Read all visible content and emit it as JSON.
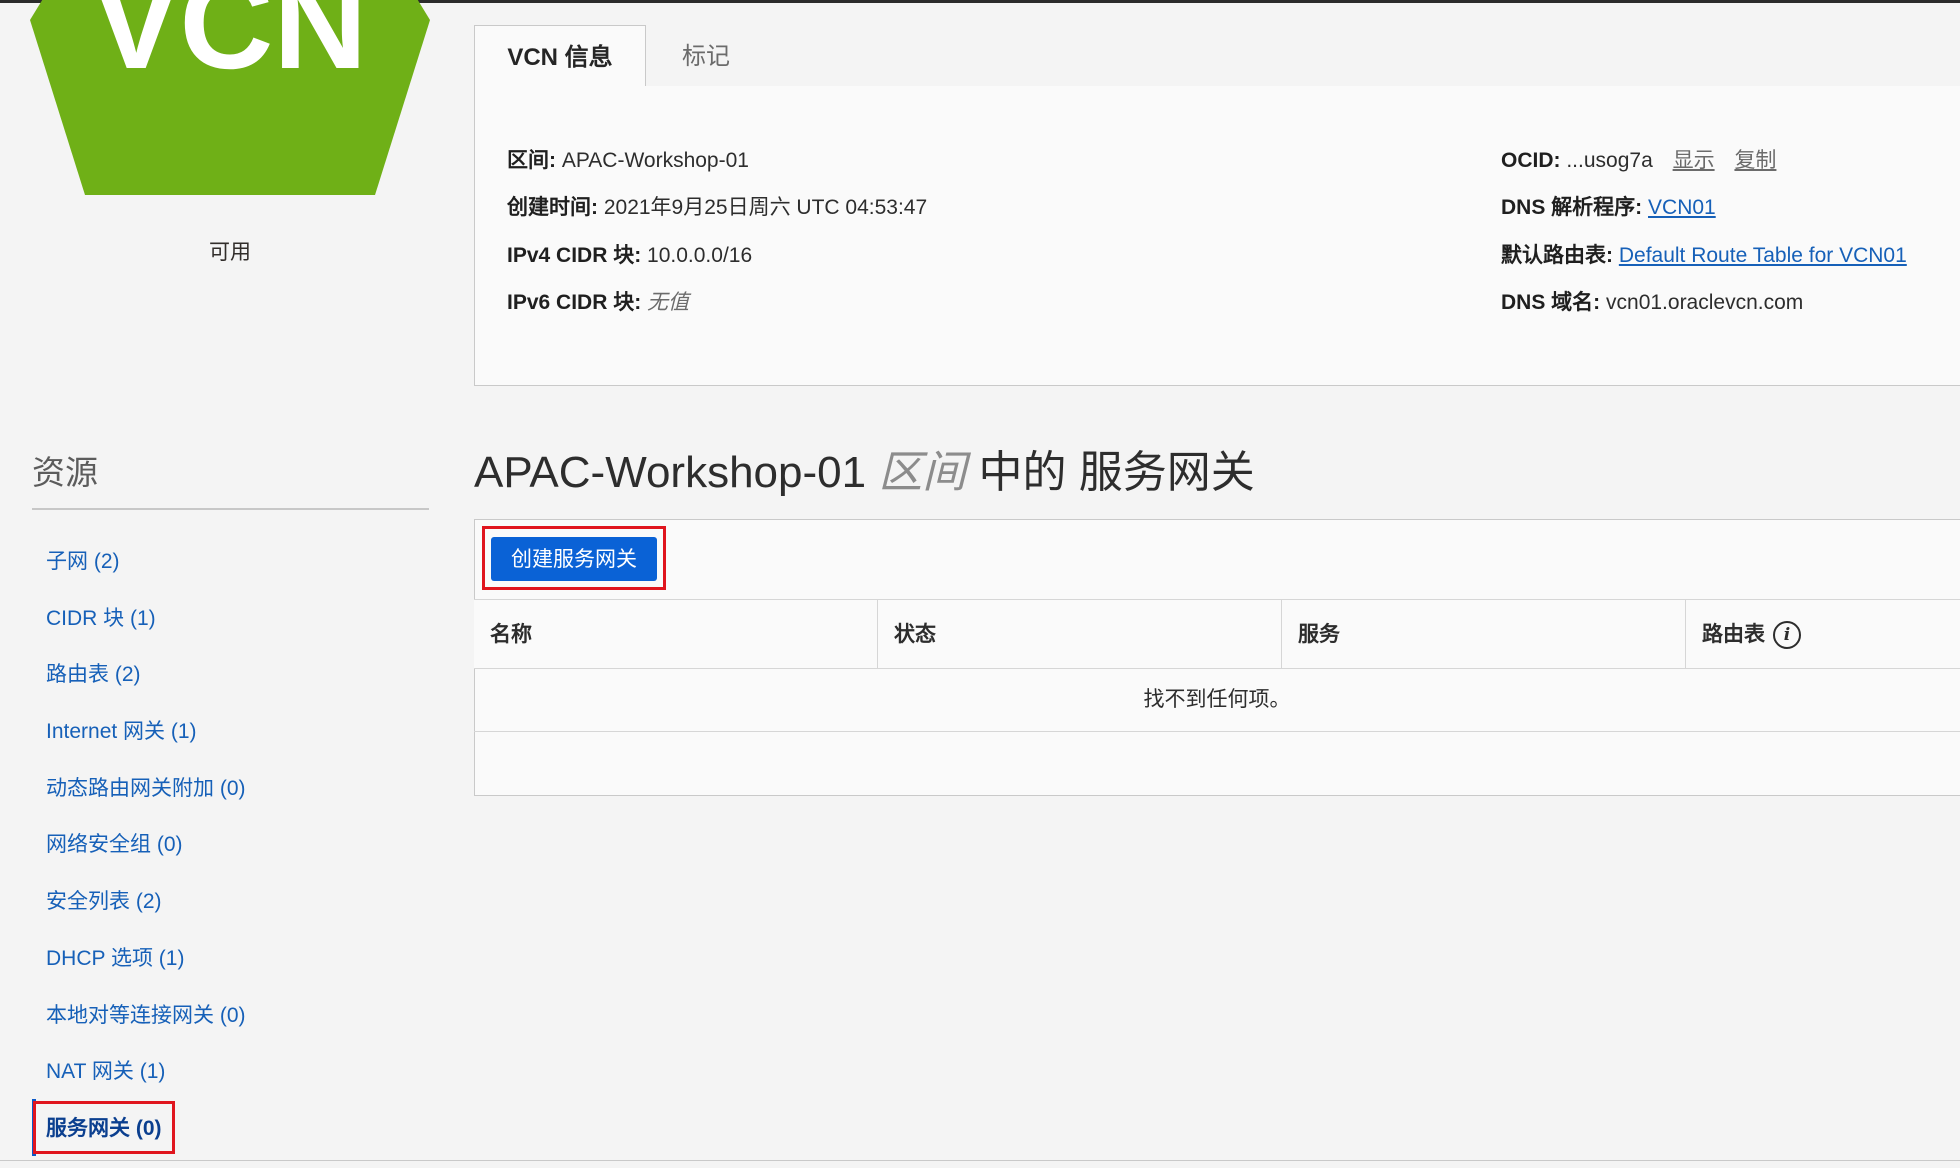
{
  "badge": {
    "text": "VCN",
    "status": "可用",
    "color": "#6fb017"
  },
  "tabs": [
    {
      "label": "VCN 信息",
      "active": true
    },
    {
      "label": "标记",
      "active": false
    }
  ],
  "info": {
    "compartment_key": "区间:",
    "compartment_value": "APAC-Workshop-01",
    "created_key": "创建时间:",
    "created_value": "2021年9月25日周六 UTC 04:53:47",
    "ipv4_key": "IPv4 CIDR 块:",
    "ipv4_value": "10.0.0.0/16",
    "ipv6_key": "IPv6 CIDR 块:",
    "ipv6_value": "无值",
    "ocid_key": "OCID:",
    "ocid_value": "...usog7a",
    "ocid_show": "显示",
    "ocid_copy": "复制",
    "dns_resolver_key": "DNS 解析程序:",
    "dns_resolver_value": "VCN01",
    "route_table_key": "默认路由表:",
    "route_table_value": "Default Route Table for VCN01",
    "dns_domain_key": "DNS 域名:",
    "dns_domain_value": "vcn01.oraclevcn.com"
  },
  "resources": {
    "title": "资源",
    "items": [
      {
        "label": "子网 (2)"
      },
      {
        "label": "CIDR 块 (1)"
      },
      {
        "label": "路由表 (2)"
      },
      {
        "label": "Internet 网关 (1)"
      },
      {
        "label": "动态路由网关附加 (0)"
      },
      {
        "label": "网络安全组 (0)"
      },
      {
        "label": "安全列表 (2)"
      },
      {
        "label": "DHCP 选项 (1)"
      },
      {
        "label": "本地对等连接网关 (0)"
      },
      {
        "label": "NAT 网关 (1)"
      },
      {
        "label": "服务网关 (0)",
        "active": true
      }
    ]
  },
  "heading": {
    "compartment": "APAC-Workshop-01",
    "compartment_word": "区间",
    "suffix": "中的 服务网关"
  },
  "table": {
    "create_button": "创建服务网关",
    "columns": [
      "名称",
      "状态",
      "服务",
      "路由表"
    ],
    "empty_message": "找不到任何项。"
  },
  "colors": {
    "primary_button": "#0a62d6",
    "link": "#1660b8",
    "highlight": "#e0151e"
  }
}
